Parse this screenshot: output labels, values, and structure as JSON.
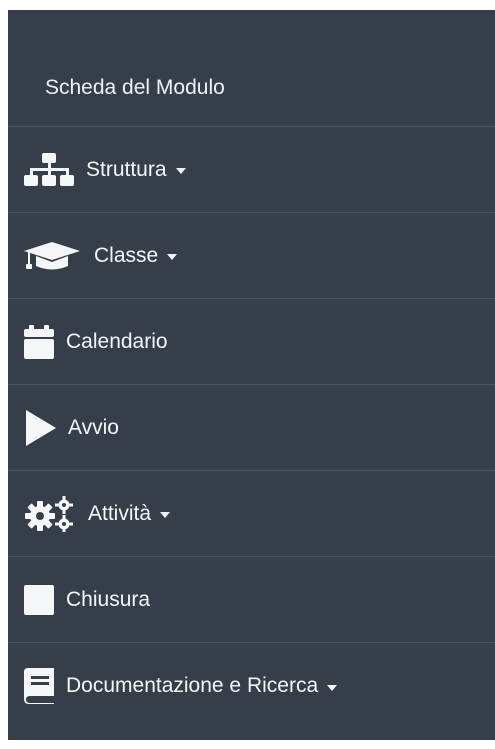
{
  "sidebar": {
    "header_label": "Scheda del Modulo",
    "items": [
      {
        "label": "Struttura",
        "icon": "sitemap-icon",
        "dropdown": true
      },
      {
        "label": "Classe",
        "icon": "graduation-cap-icon",
        "dropdown": true
      },
      {
        "label": "Calendario",
        "icon": "calendar-icon",
        "dropdown": false
      },
      {
        "label": "Avvio",
        "icon": "play-icon",
        "dropdown": false
      },
      {
        "label": "Attività",
        "icon": "cogs-icon",
        "dropdown": true
      },
      {
        "label": "Chiusura",
        "icon": "stop-icon",
        "dropdown": false
      },
      {
        "label": "Documentazione e Ricerca",
        "icon": "book-icon",
        "dropdown": true
      }
    ]
  },
  "colors": {
    "sidebar_bg": "#353e49",
    "divider": "#4b5461",
    "text": "#f4f6f8"
  }
}
